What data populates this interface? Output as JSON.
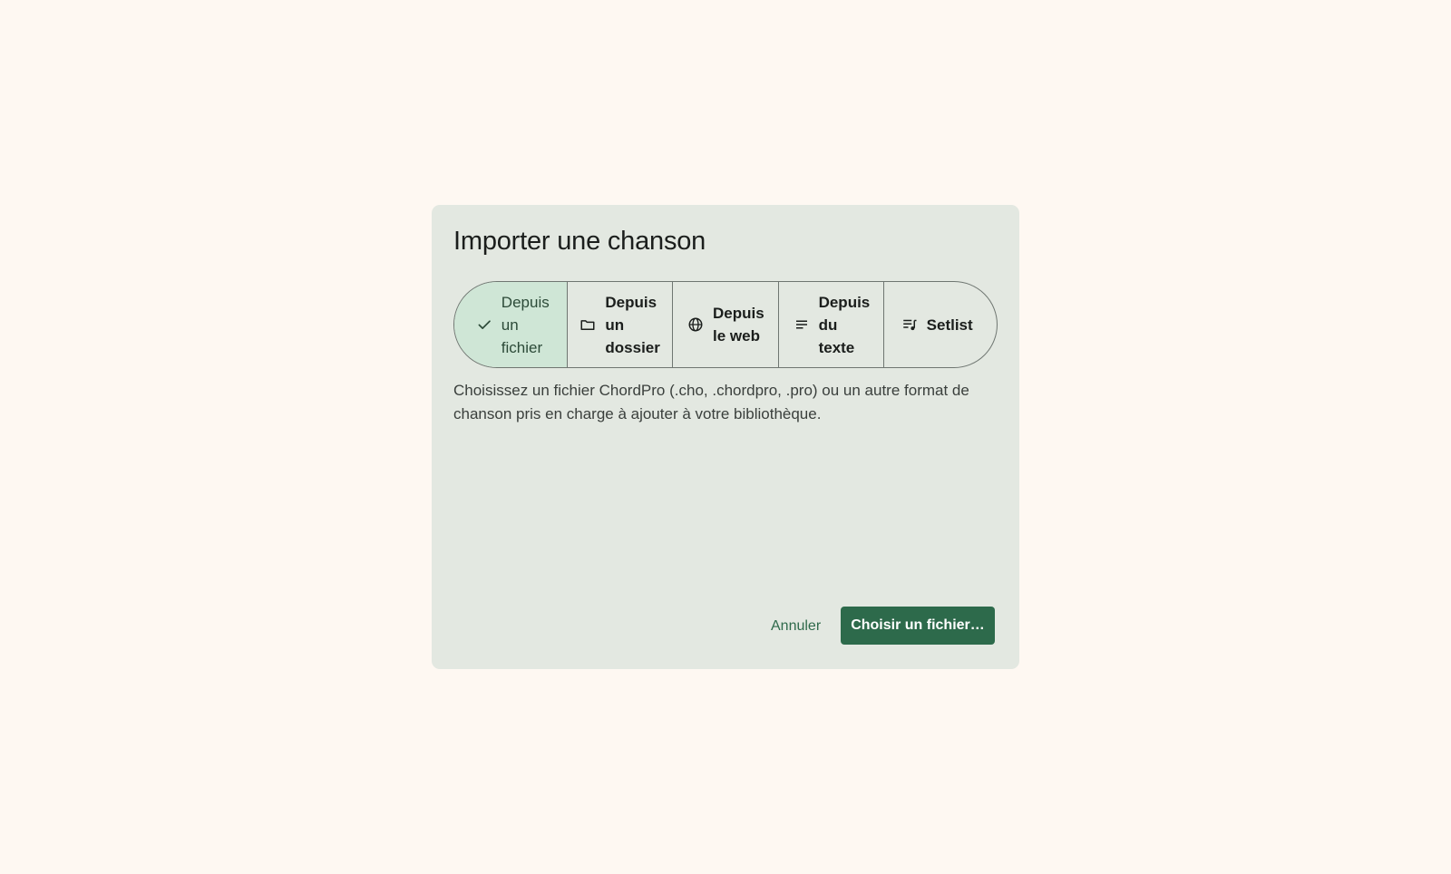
{
  "dialog": {
    "title": "Importer une chanson",
    "tabs": [
      {
        "label": "Depuis un fichier",
        "icon": "check-icon",
        "selected": true
      },
      {
        "label": "Depuis un dossier",
        "icon": "folder-icon",
        "selected": false
      },
      {
        "label": "Depuis le web",
        "icon": "globe-icon",
        "selected": false
      },
      {
        "label": "Depuis du texte",
        "icon": "text-lines-icon",
        "selected": false
      },
      {
        "label": "Setlist",
        "icon": "playlist-music-icon",
        "selected": false
      }
    ],
    "description": "Choisissez un fichier ChordPro (.cho, .chordpro, .pro) ou un autre format de chanson pris en charge à ajouter à votre bibliothèque.",
    "cancel_label": "Annuler",
    "primary_label": "Choisir un fichier…"
  },
  "colors": {
    "page_background": "#fef8f2",
    "dialog_background": "#e3e8e1",
    "selected_tab": "#cfe6d6",
    "primary": "#2d6a4b",
    "outline": "#6f7671"
  }
}
